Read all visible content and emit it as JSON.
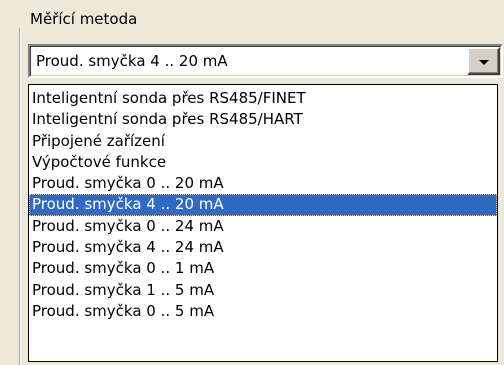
{
  "group": {
    "label": "Měřící metoda"
  },
  "combo": {
    "value": "Proud. smyčka 4 .. 20 mA"
  },
  "dropdown": {
    "options": [
      {
        "label": "Inteligentní sonda přes RS485/FINET",
        "selected": false
      },
      {
        "label": "Inteligentní sonda přes RS485/HART",
        "selected": false
      },
      {
        "label": "Připojené zařízení",
        "selected": false
      },
      {
        "label": "Výpočtové funkce",
        "selected": false
      },
      {
        "label": "Proud. smyčka 0 .. 20 mA",
        "selected": false
      },
      {
        "label": "Proud. smyčka 4 .. 20 mA",
        "selected": true
      },
      {
        "label": "Proud. smyčka 0 .. 24 mA",
        "selected": false
      },
      {
        "label": "Proud. smyčka 4 .. 24 mA",
        "selected": false
      },
      {
        "label": "Proud. smyčka 0 .. 1 mA",
        "selected": false
      },
      {
        "label": "Proud. smyčka 1 .. 5 mA",
        "selected": false
      },
      {
        "label": "Proud. smyčka 0 .. 5 mA",
        "selected": false
      }
    ]
  },
  "colors": {
    "window_bg": "#ece9d8",
    "selection_bg": "#316ac5",
    "selection_text": "#ffffff"
  },
  "icons": {
    "combo_arrow": "chevron-down-icon"
  }
}
